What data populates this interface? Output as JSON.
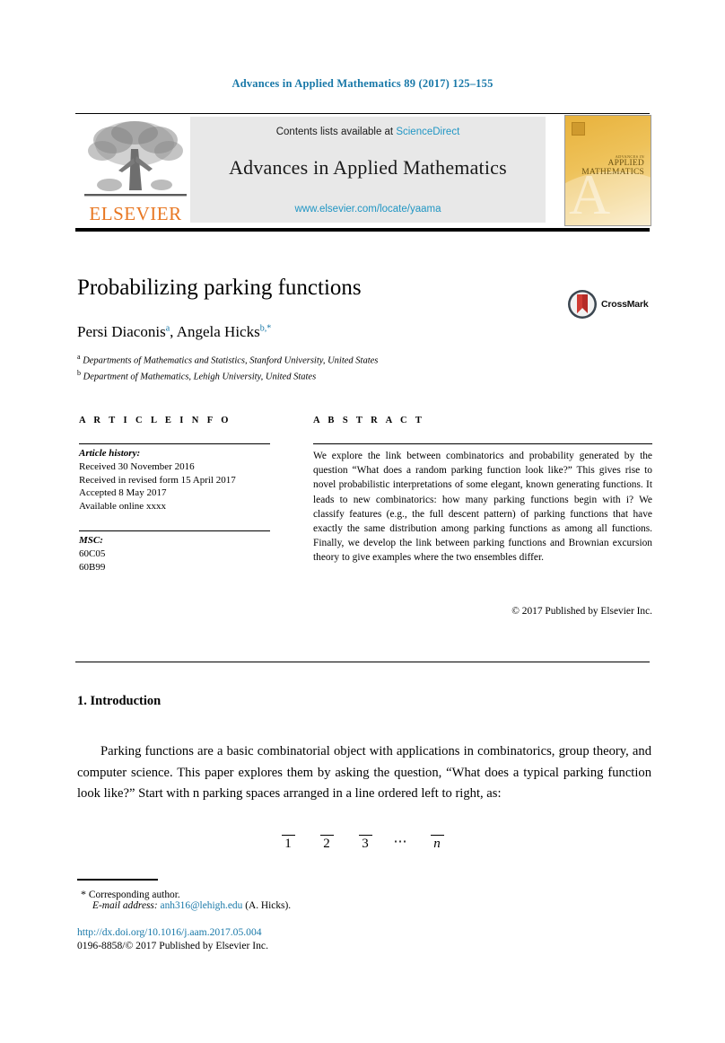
{
  "running_head": "Advances in Applied Mathematics 89 (2017) 125–155",
  "banner": {
    "contents_prefix": "Contents lists available at ",
    "sciencedirect": "ScienceDirect",
    "journal_title": "Advances in Applied Mathematics",
    "journal_url": "www.elsevier.com/locate/yaama",
    "publisher_wordmark": "ELSEVIER",
    "cover": {
      "line1": "ADVANCES IN",
      "line2": "APPLIED",
      "line3": "MATHEMATICS",
      "watermark": "A"
    }
  },
  "article": {
    "title": "Probabilizing parking functions",
    "crossmark_label": "CrossMark",
    "authors": [
      {
        "name": "Persi Diaconis",
        "marker": "a"
      },
      {
        "name": "Angela Hicks",
        "marker": "b,*"
      }
    ],
    "authors_line_plain": "Persi Diaconis a, Angela Hicks b,*",
    "affiliations": [
      {
        "marker": "a",
        "text": "Departments of Mathematics and Statistics, Stanford University, United States"
      },
      {
        "marker": "b",
        "text": "Department of Mathematics, Lehigh University, United States"
      }
    ]
  },
  "info": {
    "heading": "A R T I C L E   I N F O",
    "history_label": "Article history:",
    "history": [
      "Received 30 November 2016",
      "Received in revised form 15 April 2017",
      "Accepted 8 May 2017",
      "Available online xxxx"
    ],
    "msc_label": "MSC:",
    "msc": [
      "60C05",
      "60B99"
    ]
  },
  "abstract": {
    "heading": "A B S T R A C T",
    "body": "We explore the link between combinatorics and probability generated by the question “What does a random parking function look like?” This gives rise to novel probabilistic interpretations of some elegant, known generating functions. It leads to new combinatorics: how many parking functions begin with i? We classify features (e.g., the full descent pattern) of parking functions that have exactly the same distribution among parking functions as among all functions. Finally, we develop the link between parking functions and Brownian excursion theory to give examples where the two ensembles differ.",
    "copyright": "© 2017 Published by Elsevier Inc."
  },
  "body": {
    "section_number_title": "1. Introduction",
    "paragraph_1": "Parking functions are a basic combinatorial object with applications in combinatorics, group theory, and computer science. This paper explores them by asking the question, “What does a typical parking function look like?” Start with n parking spaces arranged in a line ordered left to right, as:",
    "display_slots": [
      "1",
      "2",
      "3",
      "n"
    ],
    "display_dots": "⋯"
  },
  "footnotes": {
    "corresponding_star": "*",
    "corresponding_text": "Corresponding author.",
    "email_label": "E-mail address:",
    "email": "anh316@lehigh.edu",
    "email_suffix": "(A. Hicks)."
  },
  "footer": {
    "doi": "http://dx.doi.org/10.1016/j.aam.2017.05.004",
    "issn": "0196-8858/© 2017 Published by Elsevier Inc."
  },
  "colors": {
    "link_blue": "#1878a8",
    "banner_blue": "#2196c4",
    "elsevier_orange": "#e87722",
    "cover_gold": "#e8b845",
    "crossmark_red": "#b52b27"
  }
}
